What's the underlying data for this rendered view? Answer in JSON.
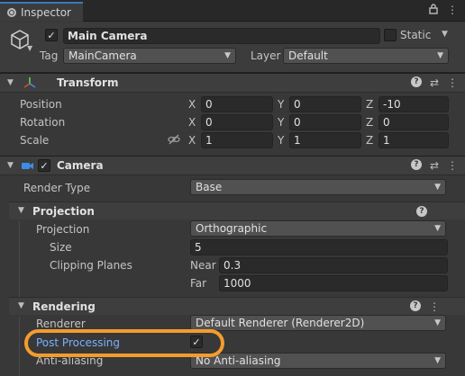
{
  "tab": {
    "title": "Inspector",
    "lock_icon": "lock-icon",
    "menu_icon": "more-vertical-icon"
  },
  "gameobject": {
    "active": true,
    "name": "Main Camera",
    "static_label": "Static",
    "static_checked": false,
    "tag_label": "Tag",
    "tag_value": "MainCamera",
    "layer_label": "Layer",
    "layer_value": "Default"
  },
  "transform": {
    "title": "Transform",
    "position_label": "Position",
    "rotation_label": "Rotation",
    "scale_label": "Scale",
    "axes": [
      "X",
      "Y",
      "Z"
    ],
    "position": [
      "0",
      "0",
      "-10"
    ],
    "rotation": [
      "0",
      "0",
      "0"
    ],
    "scale": [
      "1",
      "1",
      "1"
    ]
  },
  "camera": {
    "title": "Camera",
    "enabled": true,
    "render_type_label": "Render Type",
    "render_type_value": "Base",
    "projection": {
      "title": "Projection",
      "projection_label": "Projection",
      "projection_value": "Orthographic",
      "size_label": "Size",
      "size_value": "5",
      "clipping_label": "Clipping Planes",
      "near_label": "Near",
      "near_value": "0.3",
      "far_label": "Far",
      "far_value": "1000"
    },
    "rendering": {
      "title": "Rendering",
      "renderer_label": "Renderer",
      "renderer_value": "Default Renderer (Renderer2D)",
      "post_processing_label": "Post Processing",
      "post_processing_checked": true,
      "anti_aliasing_label": "Anti-aliasing",
      "anti_aliasing_value": "No Anti-aliasing"
    }
  },
  "colors": {
    "highlight": "#f39c2e",
    "accent_blue": "#3a79bb",
    "label_blue": "#7ab0ff"
  }
}
